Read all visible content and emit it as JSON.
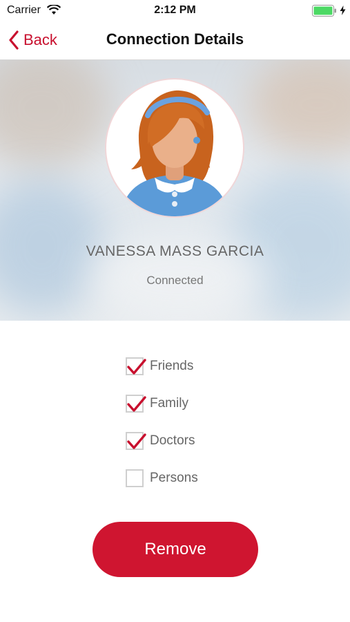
{
  "status_bar": {
    "carrier": "Carrier",
    "time": "2:12 PM",
    "wifi_icon": "wifi-icon",
    "battery_icon": "battery-charging-icon"
  },
  "nav": {
    "back_label": "Back",
    "title": "Connection Details"
  },
  "profile": {
    "name": "VANESSA MASS GARCIA",
    "status": "Connected",
    "avatar_icon": "female-avatar-icon"
  },
  "groups": [
    {
      "label": "Friends",
      "checked": true
    },
    {
      "label": "Family",
      "checked": true
    },
    {
      "label": "Doctors",
      "checked": true
    },
    {
      "label": "Persons",
      "checked": false
    }
  ],
  "actions": {
    "remove_label": "Remove"
  },
  "colors": {
    "accent": "#c8102e",
    "button": "#cf1530"
  }
}
